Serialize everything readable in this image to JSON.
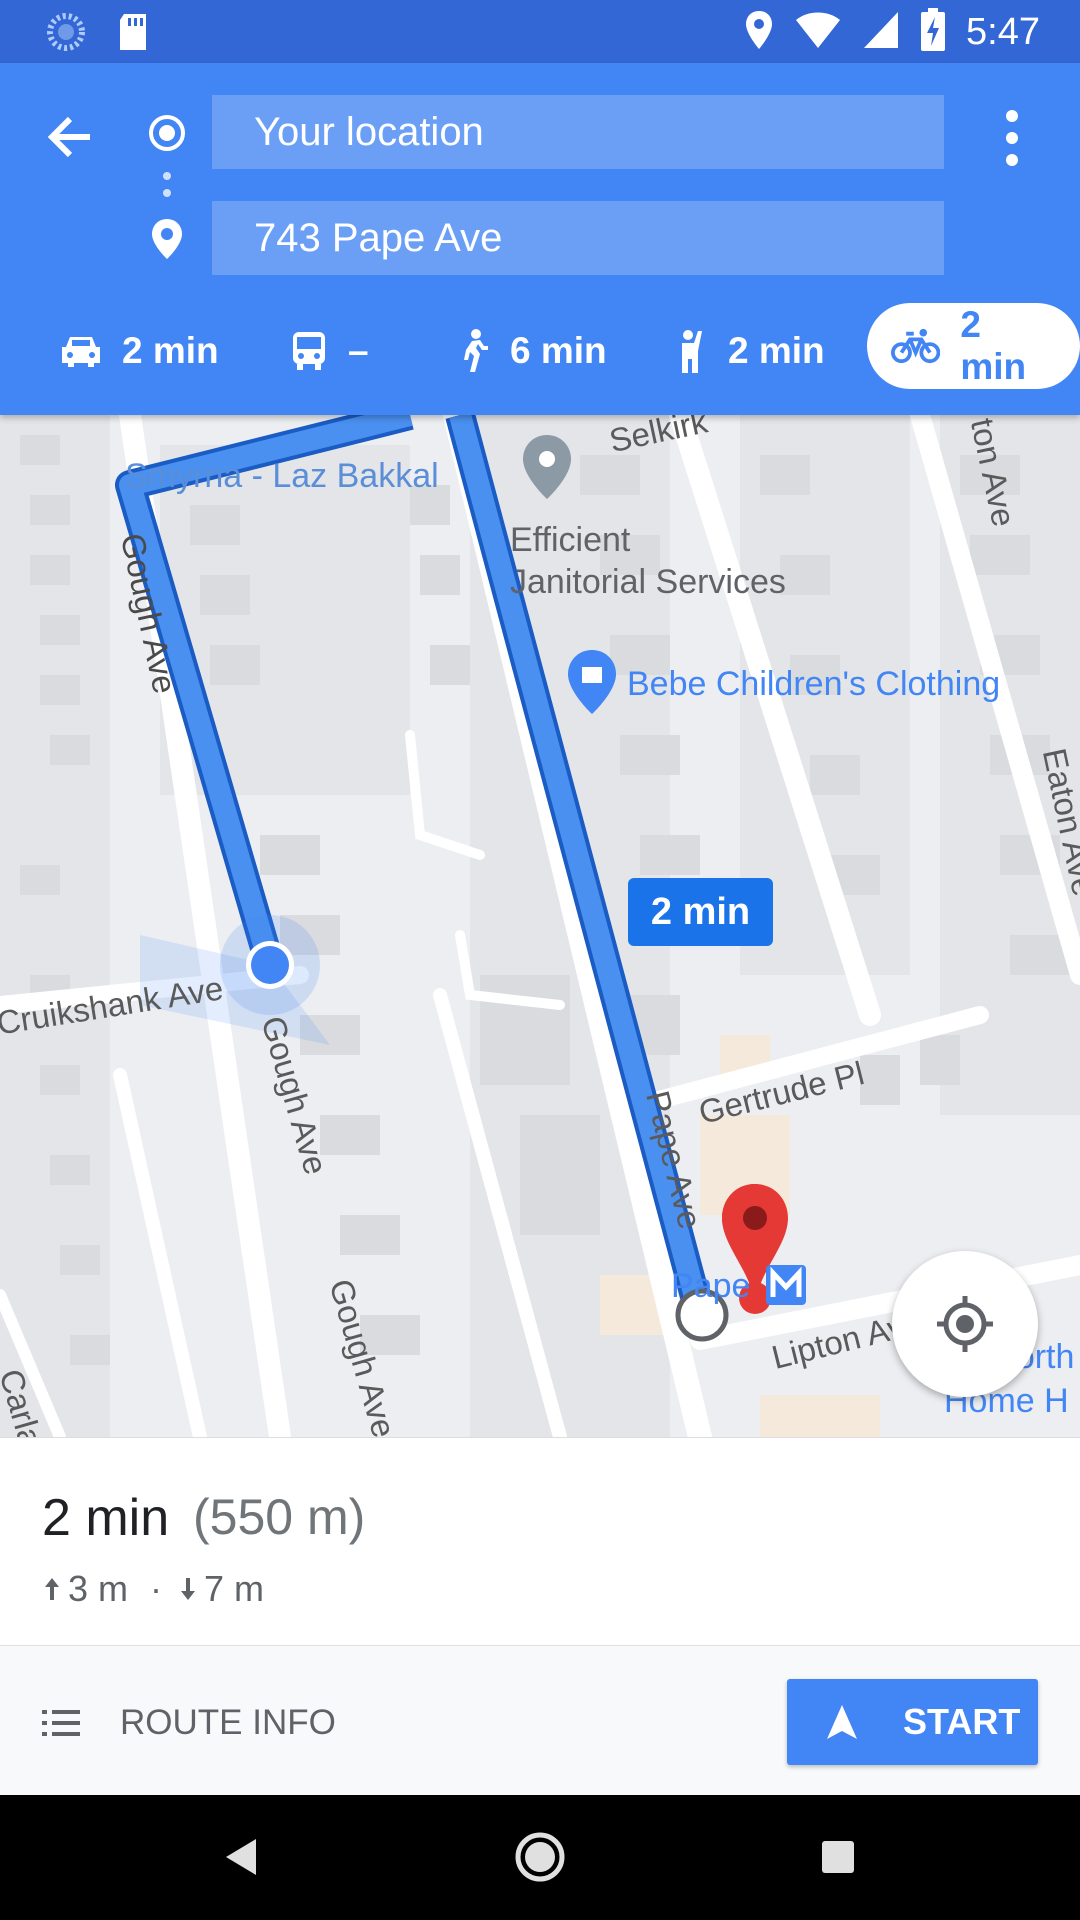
{
  "status_bar": {
    "time": "5:47",
    "icons": [
      "sync-icon",
      "sd-card-icon",
      "location-icon",
      "wifi-icon",
      "cell-signal-icon",
      "battery-charging-icon"
    ]
  },
  "directions": {
    "origin": "Your location",
    "destination": "743 Pape Ave",
    "modes": [
      {
        "name": "drive",
        "icon": "car-icon",
        "label": "2 min",
        "selected": false
      },
      {
        "name": "transit",
        "icon": "bus-icon",
        "label": "–",
        "selected": false
      },
      {
        "name": "walk",
        "icon": "walk-icon",
        "label": "6 min",
        "selected": false
      },
      {
        "name": "ride",
        "icon": "hail-icon",
        "label": "2 min",
        "selected": false
      },
      {
        "name": "bike",
        "icon": "bike-icon",
        "label": "2 min",
        "selected": true
      }
    ]
  },
  "map": {
    "streets": [
      "Gough Ave",
      "Gough Ave",
      "Gough Ave",
      "Cruikshank Ave",
      "Pape Ave",
      "Gertrude Pl",
      "Lipton Ave",
      "Selkirk",
      "Eaton Ave",
      "ton Ave",
      "Carlaw"
    ],
    "pois": [
      {
        "name": "Smyrna - Laz Bakkal",
        "color": "#5a8ed8"
      },
      {
        "name": "Efficient\nJanitorial Services",
        "color": "#5f6368"
      },
      {
        "name": "Bebe Children's Clothing",
        "color": "#4285f4"
      },
      {
        "name": "Pape",
        "color": "#4285f4"
      },
      {
        "name": "Danforth\nHome H",
        "color": "#4285f4"
      }
    ],
    "route_bubble": "2 min",
    "route_color": "#4285f4",
    "destination_marker_color": "#e53935"
  },
  "summary": {
    "duration": "2 min",
    "distance": "(550 m)",
    "ascent": "3 m",
    "separator": "·",
    "descent": "7 m"
  },
  "actions": {
    "route_info_label": "ROUTE INFO",
    "start_label": "START"
  }
}
